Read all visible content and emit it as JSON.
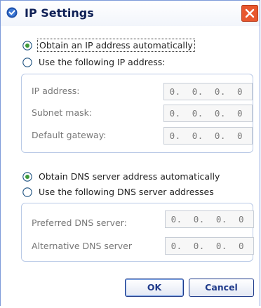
{
  "window": {
    "title": "IP Settings",
    "close_icon": "close-icon",
    "app_icon": "settings-icon",
    "accent_color": "#e9552a"
  },
  "ip": {
    "auto_label": "Obtain an IP address automatically",
    "manual_label": "Use the following IP address:",
    "selected": "auto",
    "fields": [
      {
        "label": "IP address:",
        "value": "0.  0.  0.  0"
      },
      {
        "label": "Subnet mask:",
        "value": "0.  0.  0.  0"
      },
      {
        "label": "Default gateway:",
        "value": "0.  0.  0.  0"
      }
    ]
  },
  "dns": {
    "auto_label": "Obtain DNS server address automatically",
    "manual_label": "Use the following DNS server addresses",
    "selected": "auto",
    "fields": [
      {
        "label": "Preferred DNS server:",
        "value": "0.  0.  0.  0"
      },
      {
        "label": "Alternative  DNS server",
        "value": "0.  0.  0.  0"
      }
    ]
  },
  "buttons": {
    "ok_label": "OK",
    "cancel_label": "Cancel"
  }
}
